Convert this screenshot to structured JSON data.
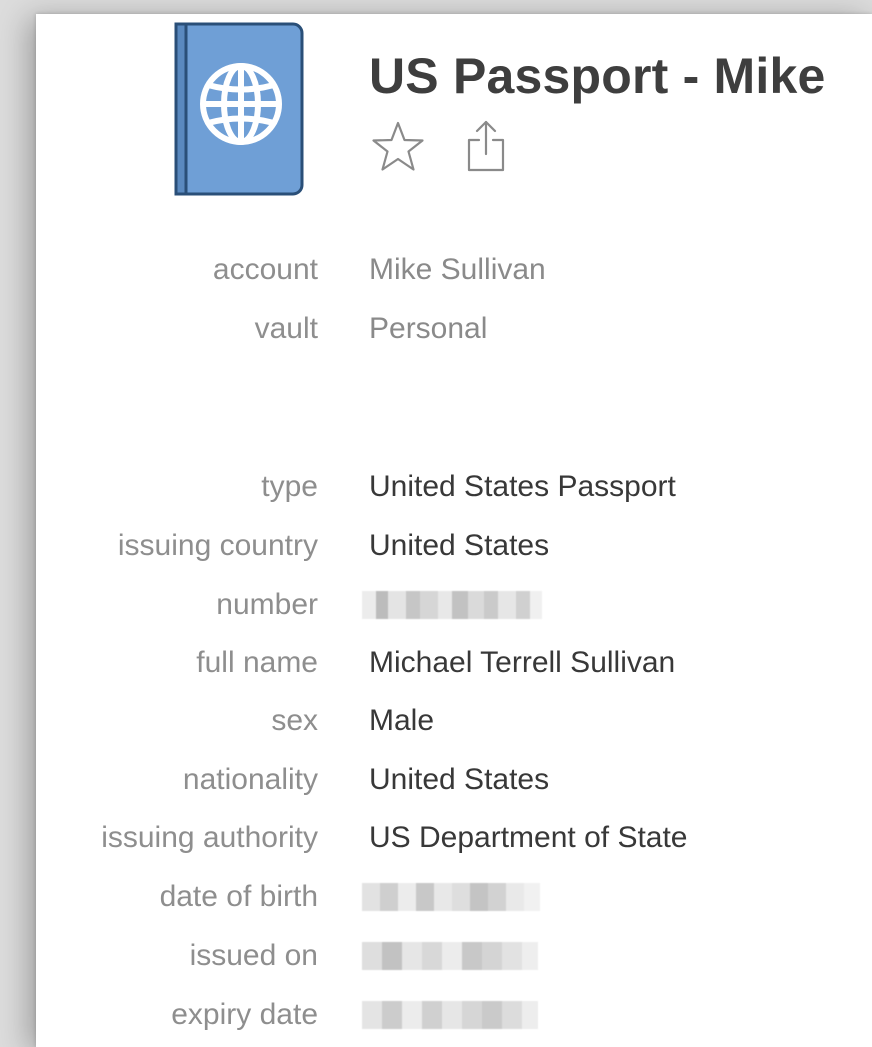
{
  "item": {
    "title": "US Passport - Mike",
    "icon": "passport-globe-icon",
    "icon_color": "#6f9fd6",
    "actions": [
      {
        "name": "favorite",
        "icon": "star-icon"
      },
      {
        "name": "share",
        "icon": "share-icon"
      }
    ]
  },
  "meta": [
    {
      "label": "account",
      "value": "Mike Sullivan"
    },
    {
      "label": "vault",
      "value": "Personal"
    }
  ],
  "fields": [
    {
      "label": "type",
      "value": "United States Passport"
    },
    {
      "label": "issuing country",
      "value": "United States"
    },
    {
      "label": "number",
      "value": ""
    },
    {
      "label": "full name",
      "value": "Michael Terrell Sullivan"
    },
    {
      "label": "sex",
      "value": "Male"
    },
    {
      "label": "nationality",
      "value": "United States"
    },
    {
      "label": "issuing authority",
      "value": "US Department of State"
    },
    {
      "label": "date of birth",
      "value": ""
    },
    {
      "label": "issued on",
      "value": ""
    },
    {
      "label": "expiry date",
      "value": ""
    }
  ]
}
